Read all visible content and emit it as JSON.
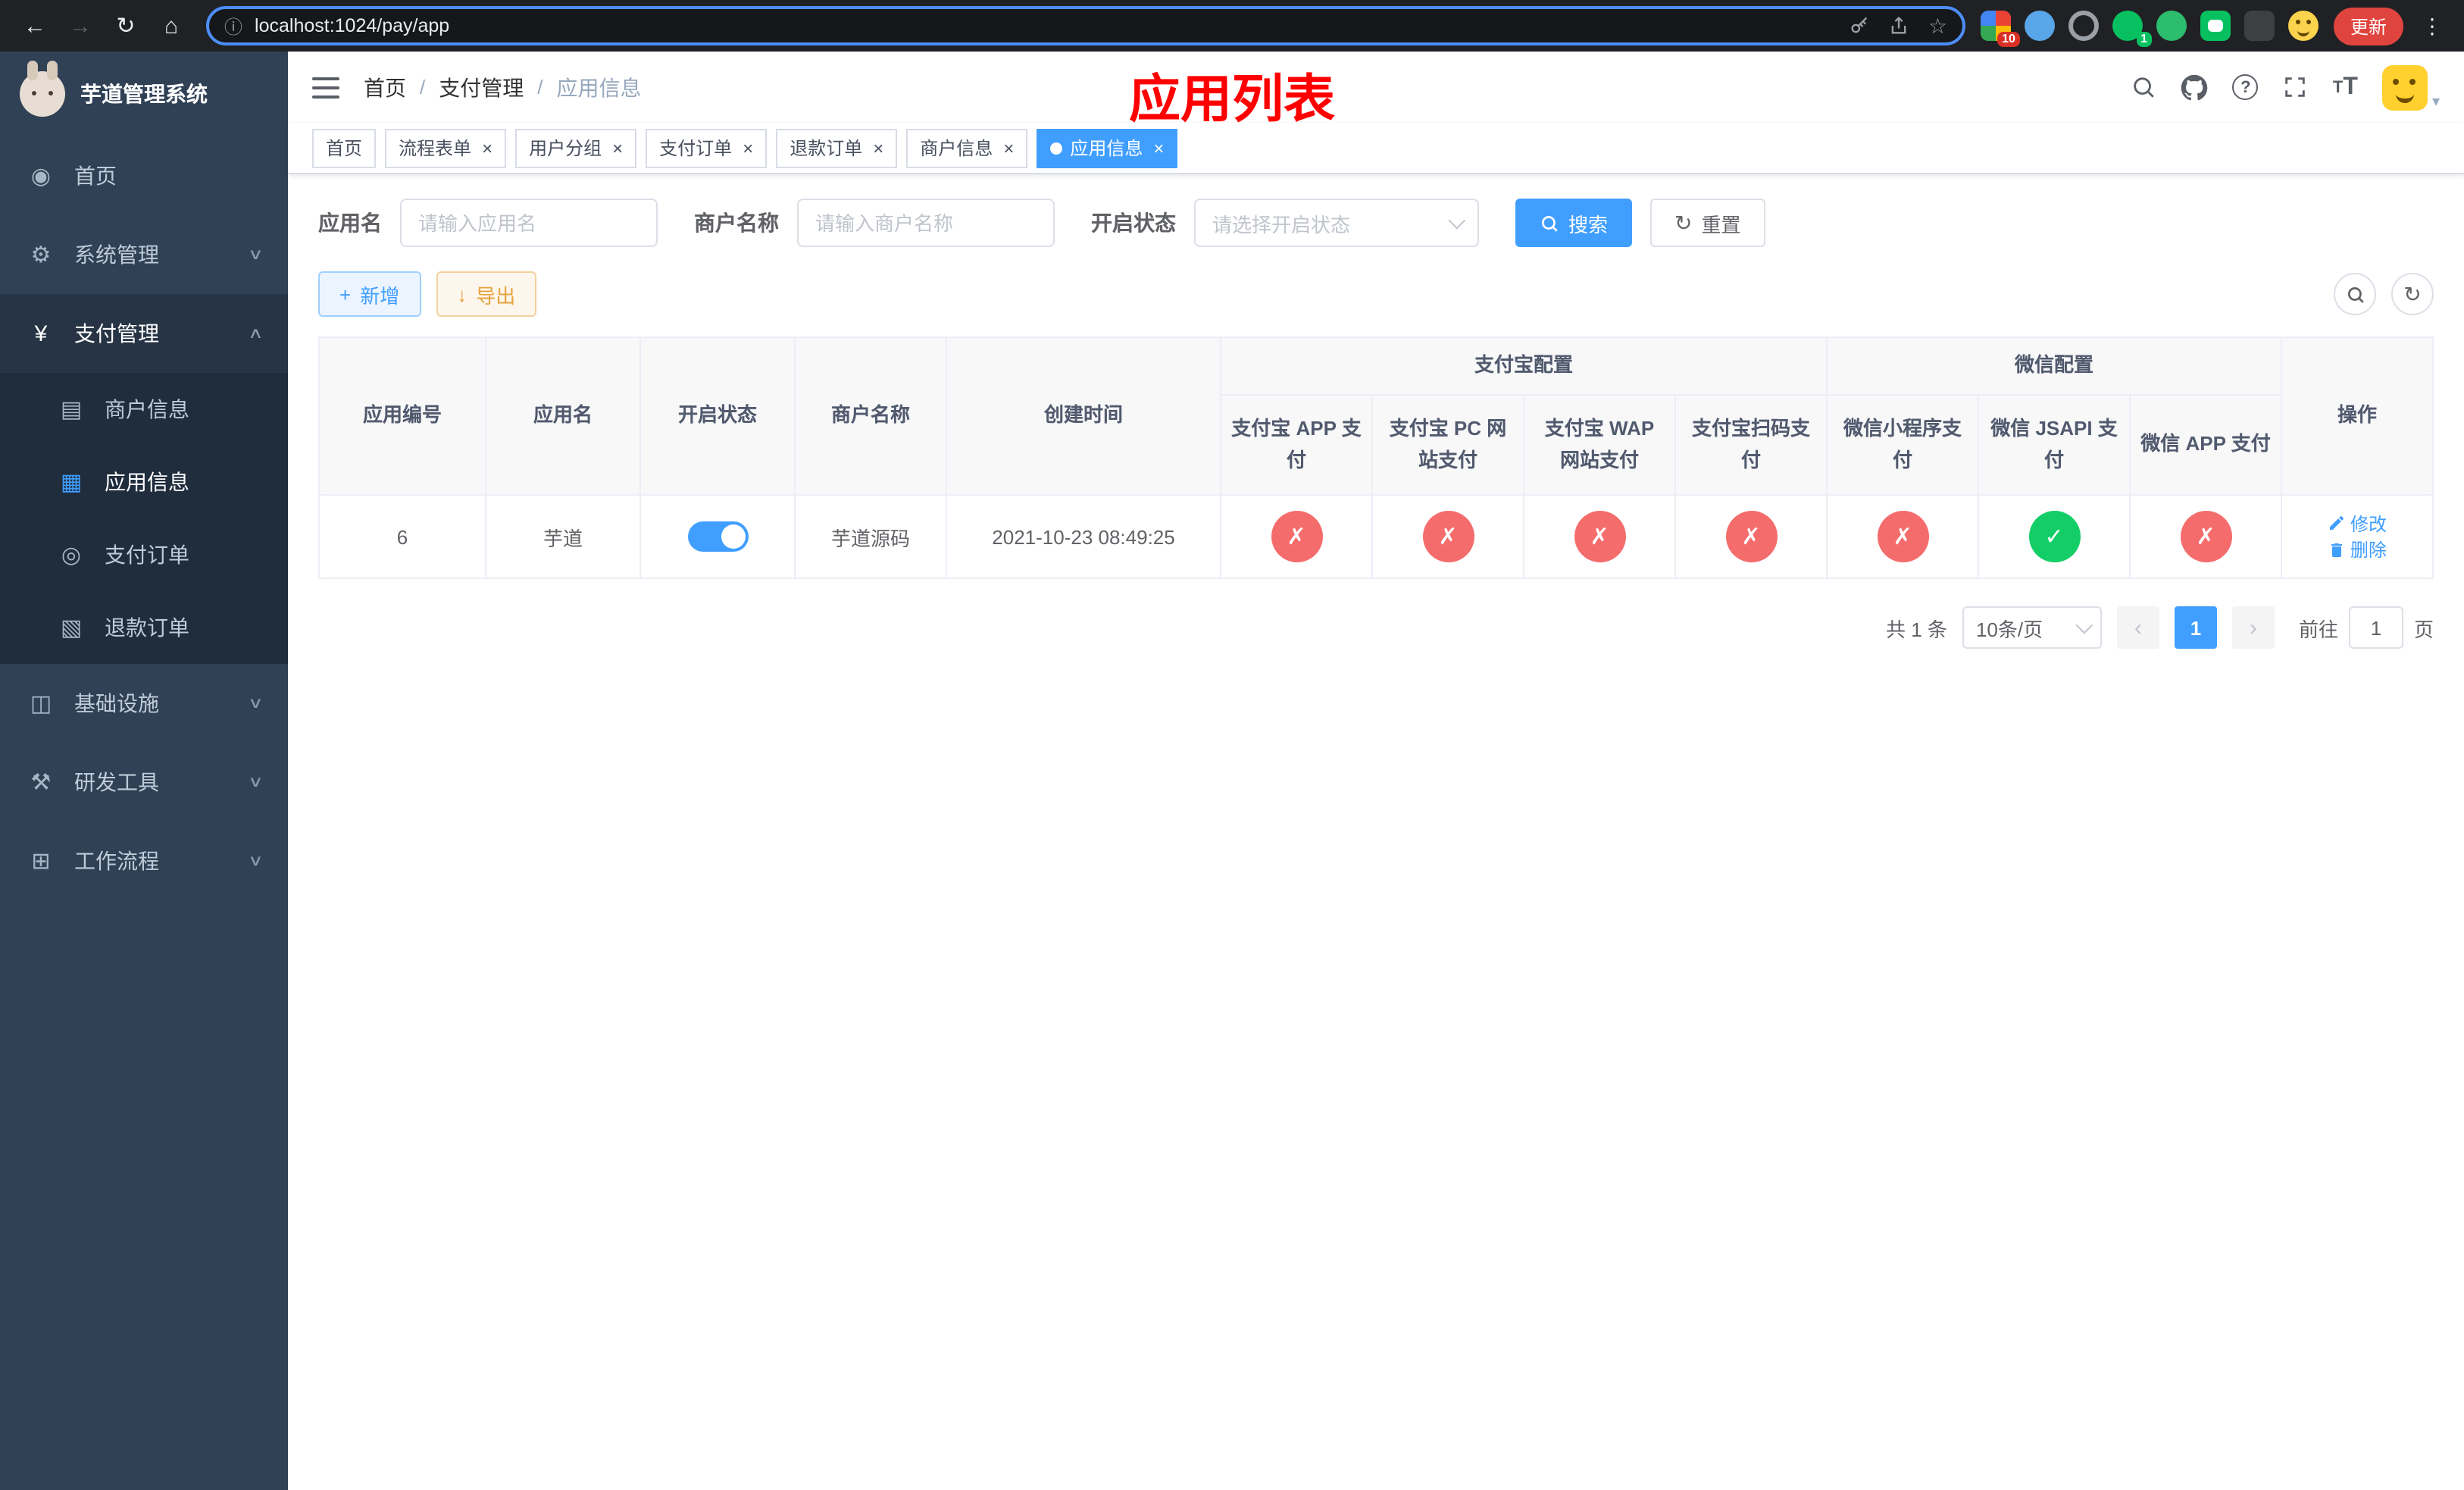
{
  "browser": {
    "url": "localhost:1024/pay/app",
    "update_label": "更新",
    "extension_badge_count": "10",
    "extension_badge_count_2": "1"
  },
  "sidebar": {
    "app_title": "芋道管理系统",
    "items": [
      {
        "icon": "dashboard-icon",
        "label": "首页",
        "glyph": "◉"
      },
      {
        "icon": "gear-icon",
        "label": "系统管理",
        "glyph": "⚙"
      },
      {
        "icon": "yen-icon",
        "label": "支付管理",
        "glyph": "¥"
      },
      {
        "icon": "server-icon",
        "label": "基础设施",
        "glyph": "◫"
      },
      {
        "icon": "tools-icon",
        "label": "研发工具",
        "glyph": "⚒"
      },
      {
        "icon": "workflow-icon",
        "label": "工作流程",
        "glyph": "⊞"
      }
    ],
    "payment_submenu": [
      {
        "icon": "card-icon",
        "label": "商户信息",
        "glyph": "▤"
      },
      {
        "icon": "grid-icon",
        "label": "应用信息",
        "glyph": "▦"
      },
      {
        "icon": "order-icon",
        "label": "支付订单",
        "glyph": "◎"
      },
      {
        "icon": "refund-icon",
        "label": "退款订单",
        "glyph": "▧"
      }
    ]
  },
  "navbar": {
    "breadcrumb": [
      "首页",
      "支付管理",
      "应用信息"
    ]
  },
  "overlay": {
    "title": "应用列表"
  },
  "tabs": [
    {
      "label": "首页"
    },
    {
      "label": "流程表单"
    },
    {
      "label": "用户分组"
    },
    {
      "label": "支付订单"
    },
    {
      "label": "退款订单"
    },
    {
      "label": "商户信息"
    },
    {
      "label": "应用信息"
    }
  ],
  "filters": {
    "app_name_label": "应用名",
    "app_name_placeholder": "请输入应用名",
    "merchant_label": "商户名称",
    "merchant_placeholder": "请输入商户名称",
    "status_label": "开启状态",
    "status_placeholder": "请选择开启状态",
    "search_label": "搜索",
    "reset_label": "重置"
  },
  "toolbar": {
    "add_label": "新增",
    "export_label": "导出"
  },
  "table": {
    "group_headers": {
      "alipay": "支付宝配置",
      "wechat": "微信配置"
    },
    "headers": {
      "id": "应用编号",
      "name": "应用名",
      "status": "开启状态",
      "merchant": "商户名称",
      "created": "创建时间",
      "alipay_app": "支付宝 APP 支付",
      "alipay_pc": "支付宝 PC 网站支付",
      "alipay_wap": "支付宝 WAP 网站支付",
      "alipay_qr": "支付宝扫码支付",
      "wx_mini": "微信小程序支付",
      "wx_jsapi": "微信 JSAPI 支付",
      "wx_app": "微信 APP 支付",
      "actions": "操作"
    },
    "rows": [
      {
        "id": "6",
        "name": "芋道",
        "enabled": true,
        "merchant": "芋道源码",
        "created": "2021-10-23 08:49:25",
        "alipay_app": false,
        "alipay_pc": false,
        "alipay_wap": false,
        "alipay_qr": false,
        "wx_mini": false,
        "wx_jsapi": true,
        "wx_app": false,
        "edit_label": "修改",
        "delete_label": "删除"
      }
    ]
  },
  "pagination": {
    "total_text": "共 1 条",
    "page_size": "10条/页",
    "current_page": "1",
    "goto_label": "前往",
    "goto_value": "1",
    "goto_unit": "页"
  },
  "icons": {
    "check": "✓",
    "cross": "✗",
    "close": "×"
  },
  "colors": {
    "accent": "#409EFF",
    "danger": "#F56C6C",
    "success": "#13CE66",
    "warning": "#E6A23C",
    "annotation": "#FF0000",
    "sidebar_bg": "#304156",
    "submenu_bg": "#1F2D3D"
  }
}
